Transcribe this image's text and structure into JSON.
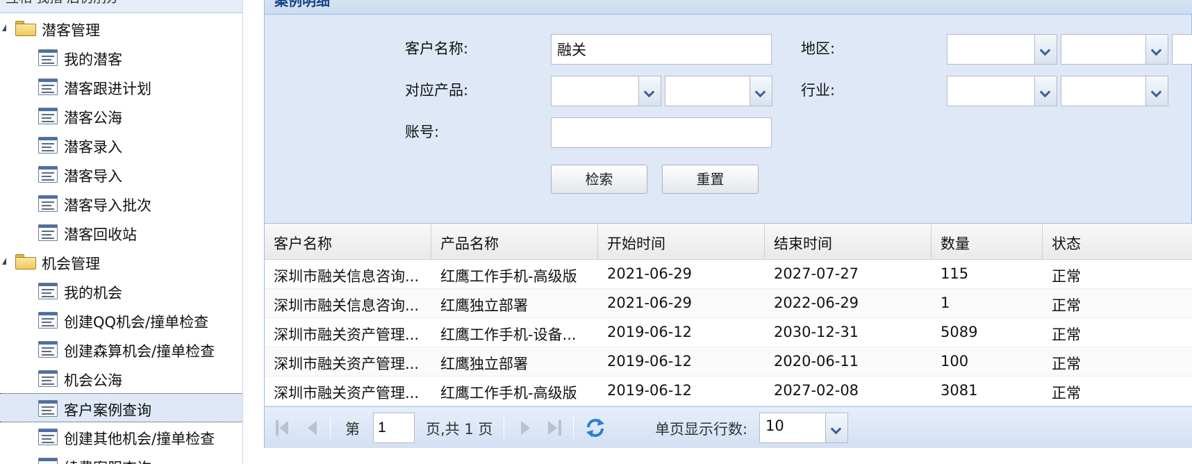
{
  "sidebar": {
    "top_partial_text": "互相  我指   后伪刖办",
    "items": [
      {
        "label": "潜客管理",
        "type": "folder"
      },
      {
        "label": "我的潜客",
        "type": "leaf"
      },
      {
        "label": "潜客跟进计划",
        "type": "leaf"
      },
      {
        "label": "潜客公海",
        "type": "leaf"
      },
      {
        "label": "潜客录入",
        "type": "leaf"
      },
      {
        "label": "潜客导入",
        "type": "leaf"
      },
      {
        "label": "潜客导入批次",
        "type": "leaf"
      },
      {
        "label": "潜客回收站",
        "type": "leaf"
      },
      {
        "label": "机会管理",
        "type": "folder"
      },
      {
        "label": "我的机会",
        "type": "leaf"
      },
      {
        "label": "创建QQ机会/撞单检查",
        "type": "leaf"
      },
      {
        "label": "创建森算机会/撞单检查",
        "type": "leaf"
      },
      {
        "label": "机会公海",
        "type": "leaf"
      },
      {
        "label": "客户案例查询",
        "type": "leaf",
        "selected": true
      },
      {
        "label": "创建其他机会/撞单检查",
        "type": "leaf"
      },
      {
        "label": "续费案服查询",
        "type": "leaf"
      }
    ]
  },
  "panel": {
    "title": "案例明细"
  },
  "search": {
    "customer_name_label": "客户名称:",
    "customer_name_value": "融关",
    "region_label": "地区:",
    "product_label": "对应产品:",
    "industry_label": "行业:",
    "account_label": "账号:",
    "account_value": "",
    "search_button": "检索",
    "reset_button": "重置"
  },
  "grid": {
    "columns": [
      "客户名称",
      "产品名称",
      "开始时间",
      "结束时间",
      "数量",
      "状态"
    ],
    "rows": [
      [
        "深圳市融关信息咨询...",
        "红鹰工作手机-高级版",
        "2021-06-29",
        "2027-07-27",
        "115",
        "正常"
      ],
      [
        "深圳市融关信息咨询...",
        "红鹰独立部署",
        "2021-06-29",
        "2022-06-29",
        "1",
        "正常"
      ],
      [
        "深圳市融关资产管理...",
        "红鹰工作手机-设备...",
        "2019-06-12",
        "2030-12-31",
        "5089",
        "正常"
      ],
      [
        "深圳市融关资产管理...",
        "红鹰独立部署",
        "2019-06-12",
        "2020-06-11",
        "100",
        "正常"
      ],
      [
        "深圳市融关资产管理...",
        "红鹰工作手机-高级版",
        "2019-06-12",
        "2027-02-08",
        "3081",
        "正常"
      ]
    ]
  },
  "pager": {
    "page_prefix": "第",
    "page_value": "1",
    "page_suffix": "页,共 1 页",
    "page_size_label": "单页显示行数:",
    "page_size_value": "10"
  },
  "colors": {
    "panel_bg": "#dfe8f6",
    "title_text": "#15428b",
    "border": "#99bbe8",
    "refresh_icon": "#2a7fd4"
  }
}
